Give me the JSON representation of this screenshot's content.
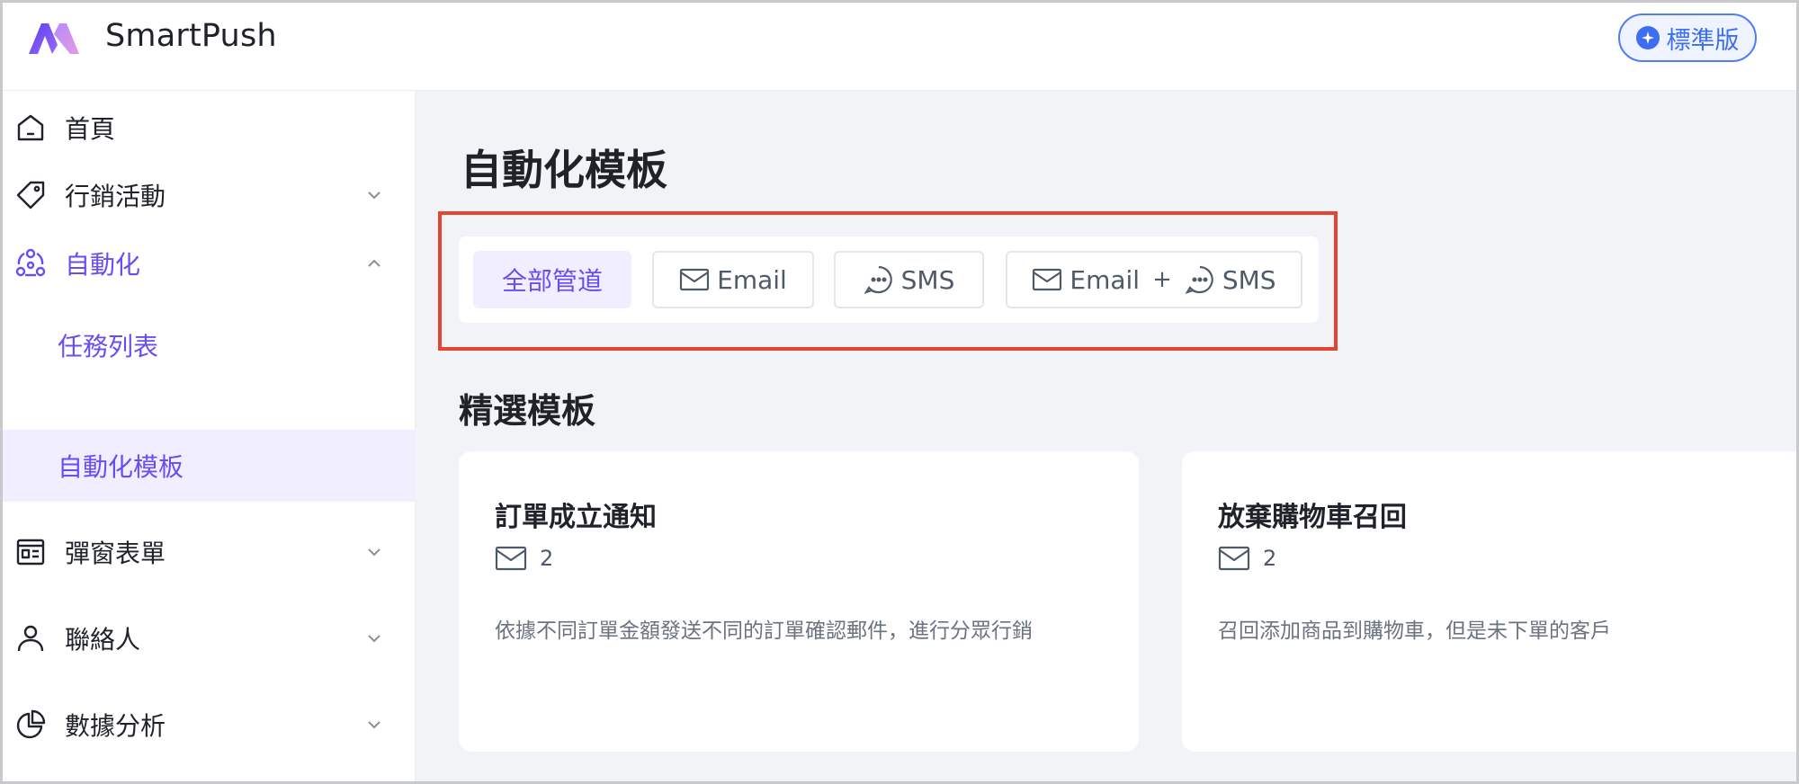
{
  "app": {
    "brand": "SmartPush",
    "plan_badge": "標準版"
  },
  "sidebar": {
    "items": [
      {
        "label": "首頁",
        "icon": "home-icon"
      },
      {
        "label": "行銷活動",
        "icon": "tag-icon"
      },
      {
        "label": "自動化",
        "icon": "automation-icon"
      },
      {
        "label": "彈窗表單",
        "icon": "form-window-icon"
      },
      {
        "label": "聯絡人",
        "icon": "user-icon"
      },
      {
        "label": "數據分析",
        "icon": "pie-chart-icon"
      }
    ],
    "sub_items": [
      {
        "label": "任務列表"
      },
      {
        "label": "自動化模板"
      }
    ]
  },
  "main": {
    "page_title": "自動化模板",
    "filters": {
      "all": "全部管道",
      "email": "Email",
      "sms": "SMS",
      "combo_email": "Email",
      "combo_plus": "+",
      "combo_sms": "SMS"
    },
    "section_title": "精選模板",
    "cards": [
      {
        "title": "訂單成立通知",
        "count": "2",
        "desc": "依據不同訂單金額發送不同的訂單確認郵件，進行分眾行銷"
      },
      {
        "title": "放棄購物車召回",
        "count": "2",
        "desc": "召回添加商品到購物車，但是未下單的客戶"
      }
    ]
  },
  "colors": {
    "accent": "#6a4cf5",
    "badge_blue": "#3d6df0",
    "highlight_red": "#e8432f",
    "main_bg": "#f2f3f6"
  }
}
